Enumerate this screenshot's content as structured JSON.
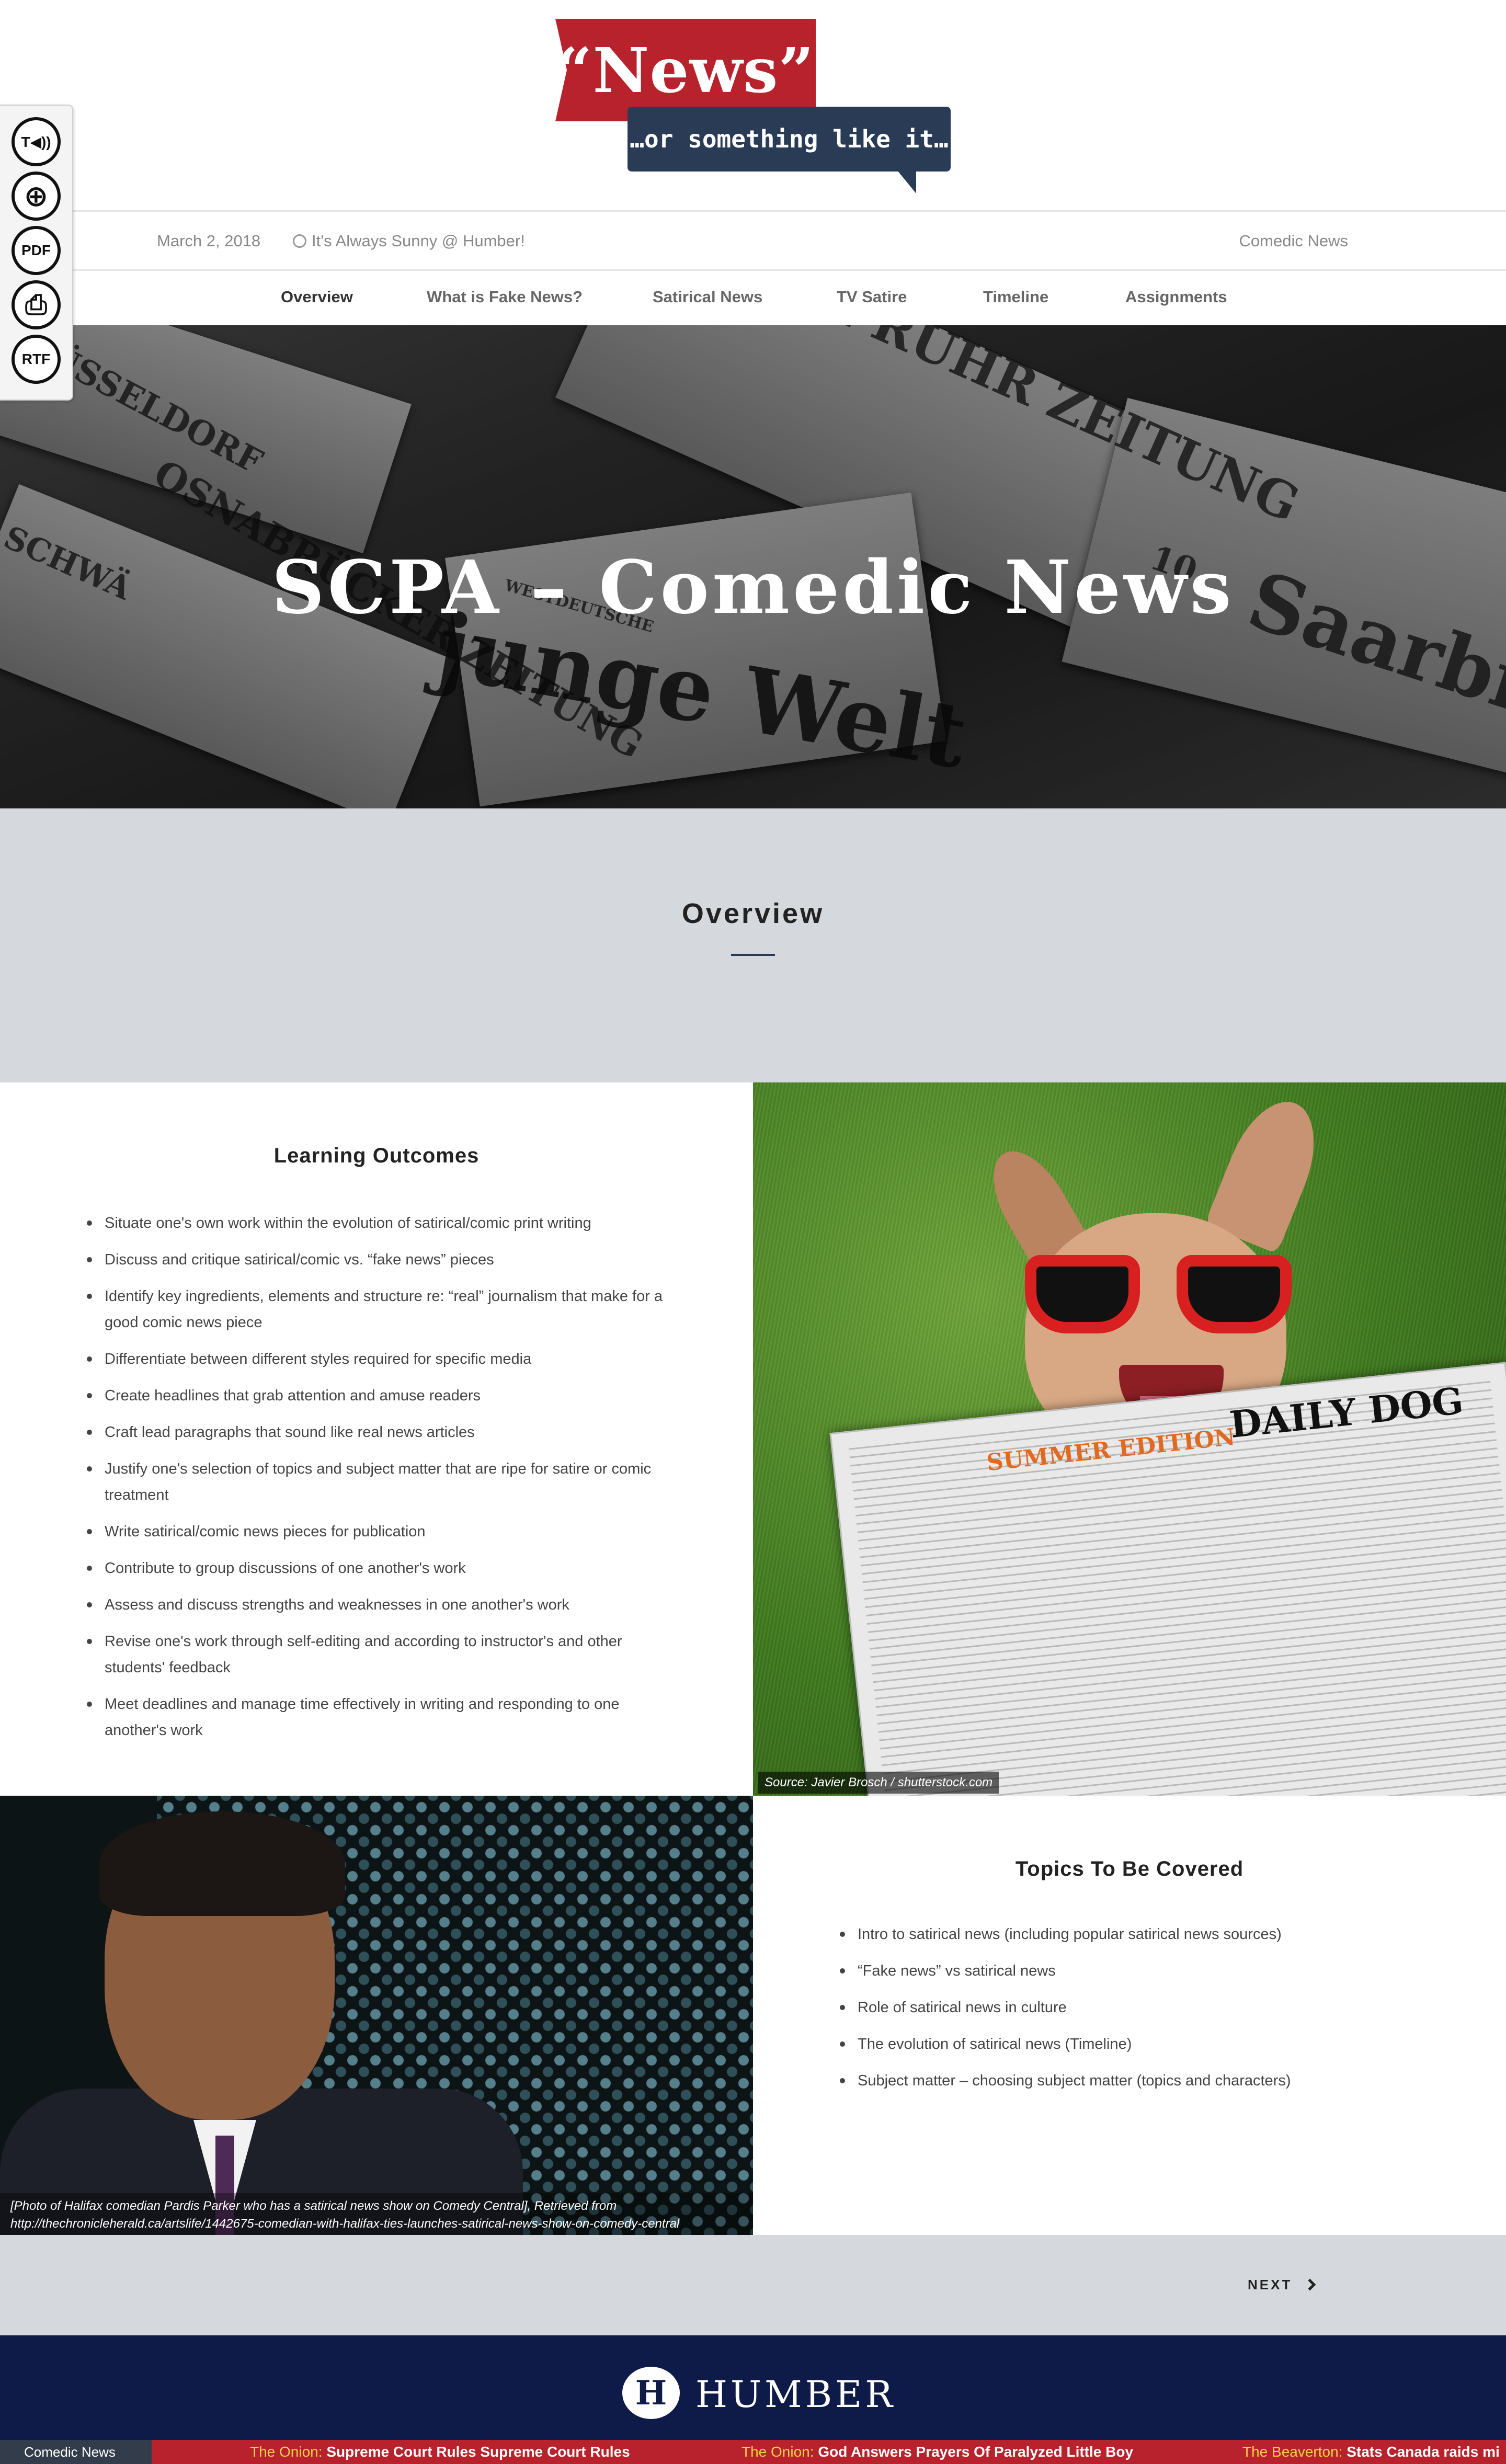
{
  "logo": {
    "title": "“News”",
    "tagline": "…or something like it…"
  },
  "toolbar": {
    "buttons": [
      {
        "label": "T◀))",
        "icon": "text-to-speech-icon"
      },
      {
        "label": "⊕",
        "icon": "zoom-icon"
      },
      {
        "label": "PDF",
        "icon": "pdf-icon"
      },
      {
        "label": "⎙",
        "icon": "print-icon"
      },
      {
        "label": "RTF",
        "icon": "rtf-icon"
      }
    ]
  },
  "infobar": {
    "date": "March 2, 2018",
    "weather": "It's Always Sunny @ Humber!",
    "right": "Comedic News"
  },
  "nav": [
    "Overview",
    "What is Fake News?",
    "Satirical News",
    "TV Satire",
    "Timeline",
    "Assignments"
  ],
  "hero": {
    "title": "SCPA – Comedic News",
    "paper_names": [
      "NEUE RUHR ZEITUNG",
      "DÜSSELDORF",
      "OSNABRÜCKER ZEITUNG",
      "junge Welt",
      "Saarbr",
      "SCHWÄ",
      "WESTDEUTSCHE",
      "10"
    ]
  },
  "overview": {
    "title": "Overview"
  },
  "learning": {
    "title": "Learning Outcomes",
    "items": [
      "Situate one's own work within the evolution of satirical/comic print writing",
      "Discuss and critique satirical/comic vs. “fake news” pieces",
      "Identify key ingredients, elements and structure re: “real” journalism that make for a good comic news piece",
      "Differentiate between different styles required for specific media",
      "Create headlines that grab attention and amuse readers",
      "Craft lead paragraphs that sound like real news articles",
      "Justify one's selection of topics and subject matter that are ripe for satire or comic treatment",
      "Write satirical/comic news pieces for publication",
      "Contribute to group discussions of one another's work",
      "Assess and discuss strengths and weaknesses in one another's work",
      "Revise one's work through self-editing and according to instructor's and other students' feedback",
      "Meet deadlines and manage time effectively in writing and responding to one another's work"
    ]
  },
  "dog_image": {
    "caption": "Source: Javier Brosch / shutterstock.com",
    "paper_title": "DAILY DOG",
    "paper_sub": "SUMMER EDITION"
  },
  "comedian_image": {
    "caption": "[Photo of Halifax comedian Pardis Parker who has a satirical news show on Comedy Central], Retrieved from http://thechronicleherald.ca/artslife/1442675-comedian-with-halifax-ties-launches-satirical-news-show-on-comedy-central"
  },
  "topics": {
    "title": "Topics To Be Covered",
    "items": [
      "Intro to satirical news (including popular satirical news sources)",
      "“Fake news” vs satirical news",
      "Role of satirical news in culture",
      "The evolution of satirical news (Timeline)",
      "Subject matter – choosing subject matter (topics and characters)"
    ]
  },
  "pager": {
    "next_label": "NEXT"
  },
  "footer": {
    "brand": "HUMBER",
    "mark": "H"
  },
  "ticker": {
    "label": "Comedic News",
    "items": [
      {
        "source": "The Onion:",
        "headline": "Supreme Court Rules Supreme Court Rules"
      },
      {
        "source": "The Onion:",
        "headline": "God Answers Prayers Of Paralyzed Little Boy"
      },
      {
        "source": "The Beaverton:",
        "headline": "Stats Canada raids mi"
      }
    ]
  },
  "colors": {
    "brand_red": "#b8222c",
    "navy": "#0e1a47",
    "logo_blue": "#2a3c55",
    "section_gray": "#d5d9dd",
    "ticker_source": "#f2d14a"
  }
}
